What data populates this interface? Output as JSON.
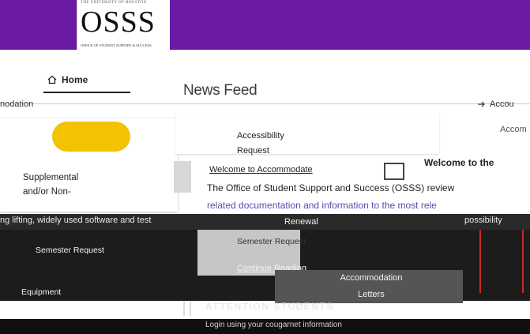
{
  "header": {
    "logo_top": "THE UNIVERSITY OF HOUSTON",
    "logo_main": "OSSS",
    "logo_sub": "OFFICE OF STUDENT SUPPORT & SUCCESS",
    "banner_color": "#6b1aa6"
  },
  "nav": {
    "home_label": "Home",
    "home_icon": "home-icon",
    "left_label": "nodation",
    "right_label": "Accou",
    "right_icon": "logout-icon"
  },
  "main": {
    "title": "News Feed",
    "accent_color": "#f3c200"
  },
  "left_card": {
    "label_lines": [
      "Supplemental",
      "and/or Non-"
    ]
  },
  "center_card": {
    "line1": "Accessibility",
    "line2": "Request",
    "right_text": "Accom"
  },
  "welcome": {
    "title": "Welcome to Accommodate",
    "header_right": "Welcome to the",
    "body": "The Office of Student Support and Success (OSSS) review",
    "body2": "related documentation and information to the most rele",
    "overlap": "ng lifting, widely used software and test",
    "overlap_right": "possibility"
  },
  "dark_section": {
    "renewal": "Renewal",
    "semester_request": "Semester Request",
    "gray_block_text": "Semester Request",
    "continue_reading": "Continue Reading",
    "acc_letter_line1": "Accommodation",
    "acc_letter_line2": "Letters",
    "left_label": "Equipment",
    "section_heading": "ATTENTION STUDENTS",
    "footer_text": "Login using your cougarnet information"
  }
}
